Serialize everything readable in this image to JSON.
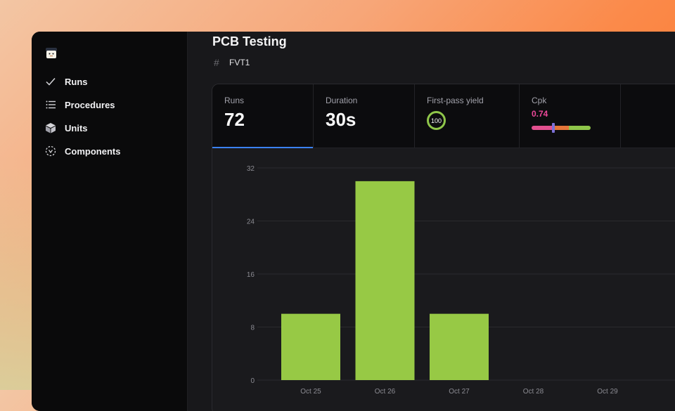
{
  "sidebar": {
    "items": [
      {
        "label": "Runs",
        "icon": "check-icon"
      },
      {
        "label": "Procedures",
        "icon": "list-icon"
      },
      {
        "label": "Units",
        "icon": "cube-icon"
      },
      {
        "label": "Components",
        "icon": "component-icon"
      }
    ]
  },
  "header": {
    "title": "PCB Testing",
    "hash_symbol": "#",
    "subtitle": "FVT1"
  },
  "stats": {
    "runs": {
      "label": "Runs",
      "value": "72"
    },
    "duration": {
      "label": "Duration",
      "value": "30s"
    },
    "yield": {
      "label": "First-pass yield",
      "value": "100"
    },
    "cpk": {
      "label": "Cpk",
      "value": "0.74"
    }
  },
  "colors": {
    "bar": "#97c945",
    "accent": "#3b82f6",
    "cpk": "#ec4899"
  },
  "chart_data": {
    "type": "bar",
    "categories": [
      "Oct 25",
      "Oct 26",
      "Oct 27",
      "Oct 28",
      "Oct 29"
    ],
    "values": [
      10,
      30,
      10,
      0,
      0
    ],
    "yticks": [
      0,
      8,
      16,
      24,
      32
    ],
    "ylim": [
      0,
      32
    ],
    "grid": true
  }
}
